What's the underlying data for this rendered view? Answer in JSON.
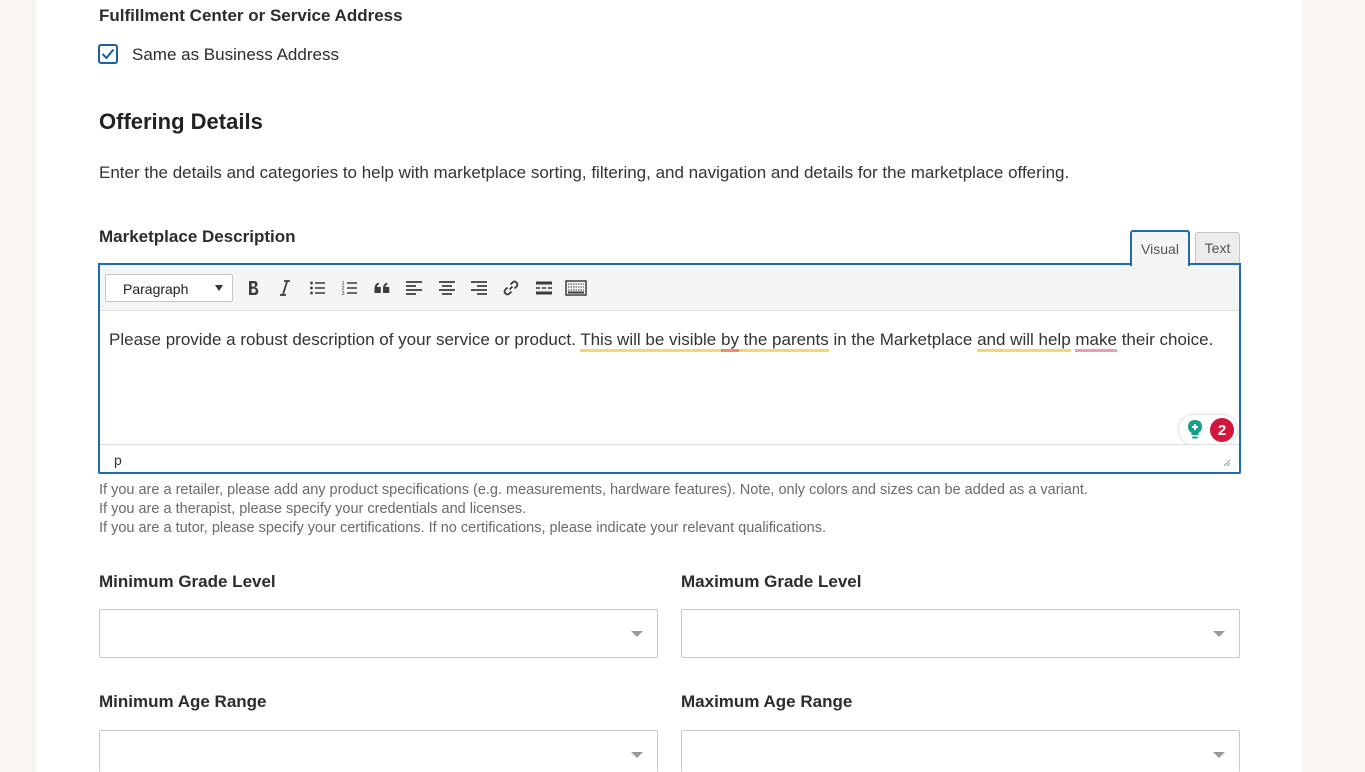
{
  "fulfillment": {
    "heading": "Fulfillment Center or Service Address",
    "same_as_label": "Same as Business Address",
    "same_as_checked": true
  },
  "offering": {
    "title": "Offering Details",
    "description": "Enter the details and categories to help with marketplace sorting, filtering, and navigation and details for the marketplace offering."
  },
  "marketplace_description": {
    "label": "Marketplace Description",
    "tabs": {
      "visual": "Visual",
      "text": "Text"
    },
    "format_select": "Paragraph",
    "content": {
      "s1": "Please provide a robust description of your service or product. ",
      "s2": "This will be visible ",
      "s3": "by",
      "s4": " the parents",
      "s5": " in the Marketplace ",
      "s6": "and will help",
      "s7": " ",
      "s8": "make",
      "s9": " their choice."
    },
    "grammarly_count": "2",
    "status_path": "p",
    "toolbar_icons": [
      "bold-icon",
      "italic-icon",
      "bullet-list-icon",
      "numbered-list-icon",
      "blockquote-icon",
      "align-left-icon",
      "align-center-icon",
      "align-right-icon",
      "link-icon",
      "read-more-icon",
      "toolbar-toggle-icon"
    ]
  },
  "help_text": [
    "If you are a retailer, please add any product specifications (e.g. measurements, hardware features). Note, only colors and sizes can be added as a variant.",
    "If you are a therapist, please specify your credentials and licenses.",
    "If you are a tutor, please specify your certifications. If no certifications, please indicate your relevant qualifications."
  ],
  "fields": {
    "min_grade": {
      "label": "Minimum Grade Level",
      "value": ""
    },
    "max_grade": {
      "label": "Maximum Grade Level",
      "value": ""
    },
    "min_age": {
      "label": "Minimum Age Range",
      "value": ""
    },
    "max_age": {
      "label": "Maximum Age Range",
      "value": ""
    }
  },
  "colors": {
    "accent": "#1d6bb0",
    "grammarly_badge": "#d3173c",
    "underline_yellow": "#f5d76b",
    "underline_orange": "#f08c6e",
    "underline_pink": "#f29bb5"
  }
}
